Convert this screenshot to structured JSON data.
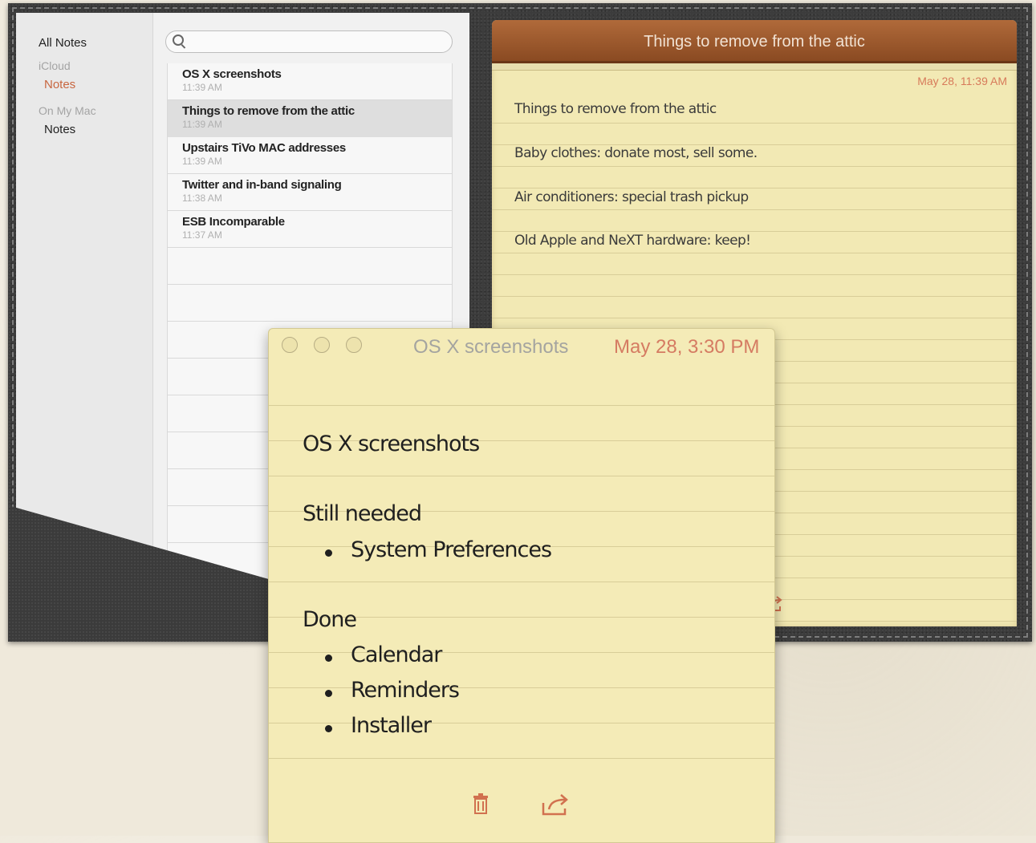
{
  "sidebar": {
    "all_notes": "All Notes",
    "groups": [
      {
        "label": "iCloud",
        "items": [
          {
            "label": "Notes",
            "active": true
          }
        ]
      },
      {
        "label": "On My Mac",
        "items": [
          {
            "label": "Notes",
            "active": false
          }
        ]
      }
    ]
  },
  "search": {
    "placeholder": "",
    "value": ""
  },
  "note_list": [
    {
      "title": "OS X screenshots",
      "time": "11:39 AM",
      "selected": false
    },
    {
      "title": "Things to remove from the attic",
      "time": "11:39 AM",
      "selected": true
    },
    {
      "title": "Upstairs TiVo MAC addresses",
      "time": "11:39 AM",
      "selected": false
    },
    {
      "title": "Twitter and in-band signaling",
      "time": "11:38 AM",
      "selected": false
    },
    {
      "title": "ESB Incomparable",
      "time": "11:37 AM",
      "selected": false
    }
  ],
  "note": {
    "header_title": "Things to remove from the attic",
    "date": "May 28, 11:39 AM",
    "lines": [
      "Things to remove from the attic",
      "Baby clothes: donate most, sell some.",
      "Air conditioners: special trash pickup",
      "Old Apple and NeXT hardware: keep!"
    ]
  },
  "float_note": {
    "title": "OS X screenshots",
    "date": "May 28, 3:30 PM",
    "heading": "OS X screenshots",
    "section1": "Still needed",
    "section1_items": [
      "System Preferences"
    ],
    "section2": "Done",
    "section2_items": [
      "Calendar",
      "Reminders",
      "Installer"
    ]
  },
  "icons": {
    "trash": "trash-icon",
    "share": "share-icon",
    "search": "search-icon"
  },
  "colors": {
    "accent": "#c8663f",
    "header_leather": "#9c5a2e",
    "paper": "#f2e9b4"
  }
}
